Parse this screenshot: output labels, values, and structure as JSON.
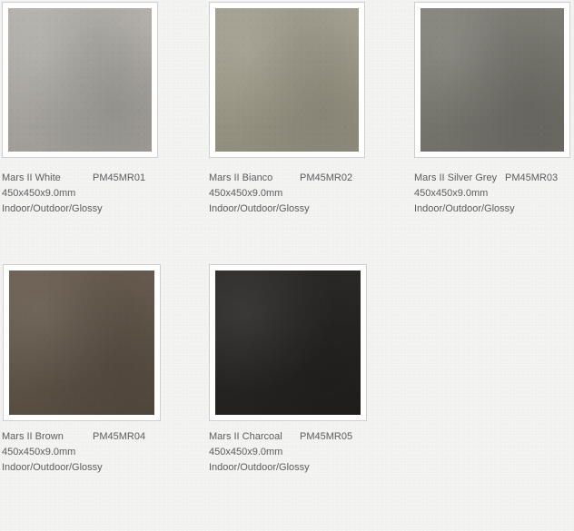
{
  "tiles": [
    {
      "name": "Mars II White",
      "code": "PM45MR01",
      "size": "450x450x9.0mm",
      "use": "Indoor/Outdoor/Glossy",
      "swatch": "light grey concrete"
    },
    {
      "name": "Mars II Bianco",
      "code": "PM45MR02",
      "size": "450x450x9.0mm",
      "use": "Indoor/Outdoor/Glossy",
      "swatch": "beige grey concrete"
    },
    {
      "name": "Mars II Silver Grey",
      "code": "PM45MR03",
      "size": "450x450x9.0mm",
      "use": "Indoor/Outdoor/Glossy",
      "swatch": "mid grey concrete"
    },
    {
      "name": "Mars II Brown",
      "code": "PM45MR04",
      "size": "450x450x9.0mm",
      "use": "Indoor/Outdoor/Glossy",
      "swatch": "brown concrete"
    },
    {
      "name": "Mars II Charcoal",
      "code": "PM45MR05",
      "size": "450x450x9.0mm",
      "use": "Indoor/Outdoor/Glossy",
      "swatch": "charcoal concrete"
    }
  ],
  "colors": {
    "page_background": "#f3f3f2",
    "frame_border": "#cfcfcf",
    "text": "#5c5c5c"
  }
}
